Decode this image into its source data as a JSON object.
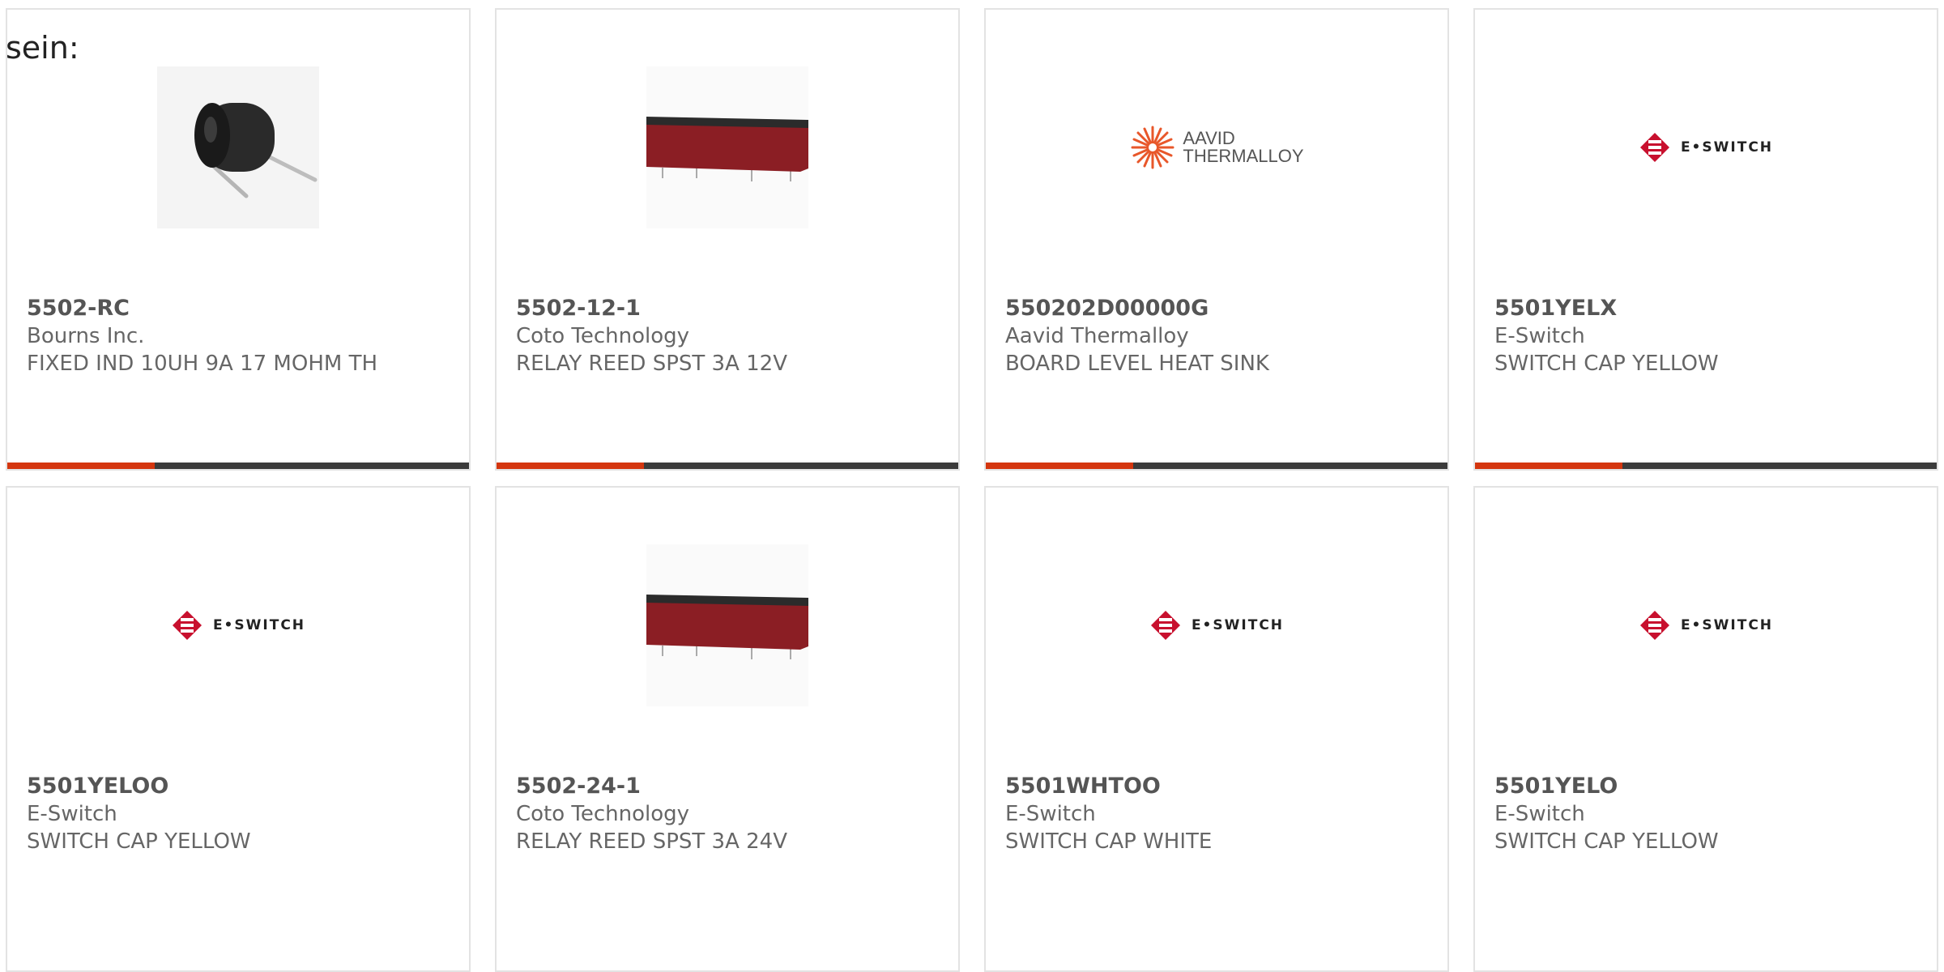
{
  "intro_text": "sein:",
  "colors": {
    "accent": "#d4360f",
    "bar_dark": "#3b3b3b",
    "eswitch_red": "#c8102e",
    "aavid_orange": "#e8572a",
    "relay_red": "#8b1e24"
  },
  "products": [
    {
      "part_number": "5502-RC",
      "manufacturer": "Bourns Inc.",
      "description": "FIXED IND 10UH 9A 17 MOHM TH",
      "image": "inductor-photo"
    },
    {
      "part_number": "5502-12-1",
      "manufacturer": "Coto Technology",
      "description": "RELAY REED SPST 3A 12V",
      "image": "reed-relay-photo"
    },
    {
      "part_number": "550202D00000G",
      "manufacturer": "Aavid Thermalloy",
      "description": "BOARD LEVEL HEAT SINK",
      "image": "aavid-thermalloy-logo",
      "logo_text": [
        "AAVID",
        "THERMALLOY"
      ]
    },
    {
      "part_number": "5501YELX",
      "manufacturer": "E-Switch",
      "description": "SWITCH CAP YELLOW",
      "image": "e-switch-logo",
      "logo_text": "E•SWITCH"
    },
    {
      "part_number": "5501YELOO",
      "manufacturer": "E-Switch",
      "description": "SWITCH CAP YELLOW",
      "image": "e-switch-logo",
      "logo_text": "E•SWITCH"
    },
    {
      "part_number": "5502-24-1",
      "manufacturer": "Coto Technology",
      "description": "RELAY REED SPST 3A 24V",
      "image": "reed-relay-photo"
    },
    {
      "part_number": "5501WHTOO",
      "manufacturer": "E-Switch",
      "description": "SWITCH CAP WHITE",
      "image": "e-switch-logo",
      "logo_text": "E•SWITCH"
    },
    {
      "part_number": "5501YELO",
      "manufacturer": "E-Switch",
      "description": "SWITCH CAP YELLOW",
      "image": "e-switch-logo",
      "logo_text": "E•SWITCH"
    }
  ]
}
